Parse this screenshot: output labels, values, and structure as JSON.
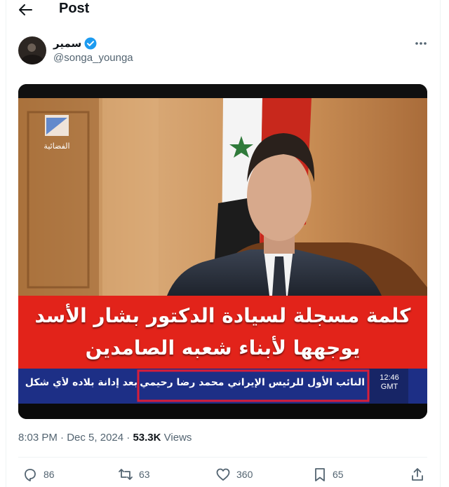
{
  "header": {
    "title": "Post"
  },
  "author": {
    "display_name": "سمير",
    "handle": "@songa_younga",
    "verified": true
  },
  "media": {
    "channel_logo_text": "الفضائية",
    "headline_line1": "كلمة مسجلة لسيادة الدكتور بشار الأسد",
    "headline_line2": "يوجهها لأبناء شعبه الصامدين",
    "ticker_highlighted": "النائب الأول للرئيس الإيراني محمد رضا رحيمي",
    "ticker_continuation": "بعد إدانة بلاده لأي شكل",
    "clock_time": "12:46",
    "clock_zone": "GMT",
    "colors": {
      "banner_red": "#e2231a",
      "ticker_blue": "#1d2f86",
      "highlight_box": "#d81e3a"
    }
  },
  "meta": {
    "time": "8:03 PM",
    "date": "Dec 5, 2024",
    "separator": "·",
    "views_count": "53.3K",
    "views_label": "Views"
  },
  "actions": {
    "replies": "86",
    "reposts": "63",
    "likes": "360",
    "bookmarks": "65"
  },
  "icons": [
    "back-arrow-icon",
    "verified-badge-icon",
    "more-icon",
    "reply-icon",
    "repost-icon",
    "like-icon",
    "bookmark-icon",
    "share-icon"
  ],
  "colors": {
    "text": "#0f1419",
    "muted": "#536471",
    "verified": "#1d9bf0",
    "divider": "#eff3f4"
  }
}
